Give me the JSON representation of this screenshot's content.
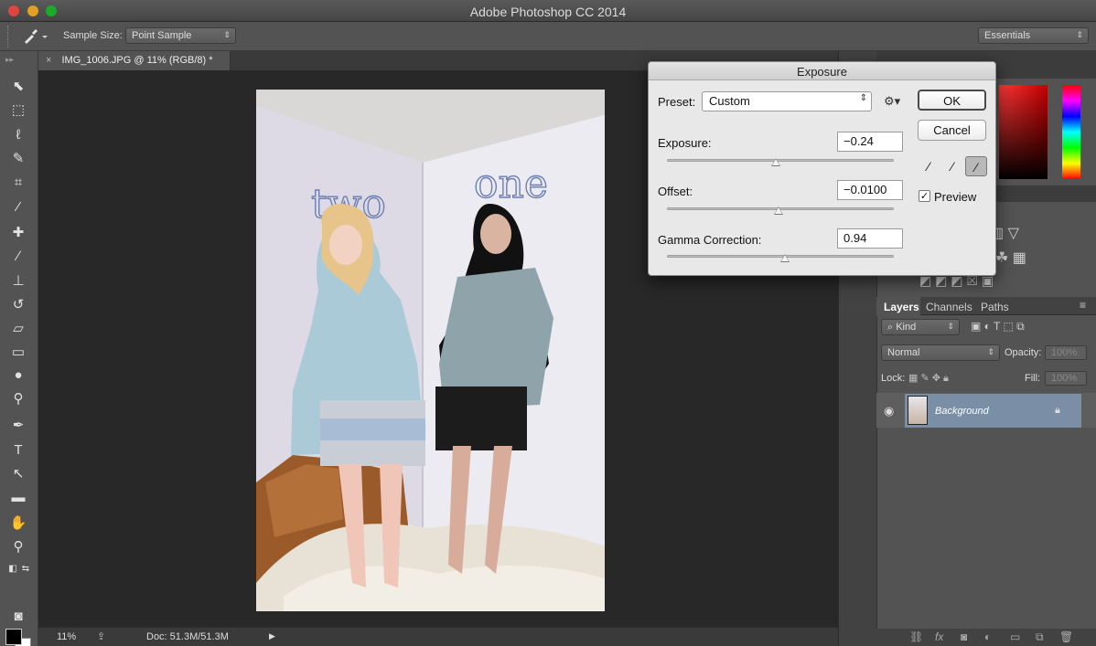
{
  "window": {
    "title": "Adobe Photoshop CC 2014"
  },
  "options_bar": {
    "tool_icon": "eyedropper-icon",
    "sample_size_label": "Sample Size:",
    "sample_size_value": "Point Sample",
    "workspace_value": "Essentials"
  },
  "document": {
    "tab_close": "×",
    "tab_label": "IMG_1006.JPG @ 11% (RGB/8) *",
    "photo_text_left": "two",
    "photo_text_right": "one"
  },
  "status": {
    "zoom": "11%",
    "doc_size": "Doc: 51.3M/51.3M"
  },
  "layers_panel": {
    "tabs": [
      "Layers",
      "Channels",
      "Paths"
    ],
    "kind_filter": "Kind",
    "blend_mode": "Normal",
    "opacity_label": "Opacity:",
    "opacity_value": "100%",
    "lock_label": "Lock:",
    "fill_label": "Fill:",
    "fill_value": "100%",
    "layer_name": "Background"
  },
  "exposure_dialog": {
    "title": "Exposure",
    "preset_label": "Preset:",
    "preset_value": "Custom",
    "exposure_label": "Exposure:",
    "exposure_value": "−0.24",
    "exposure_slider_fraction": 0.48,
    "offset_label": "Offset:",
    "offset_value": "−0.0100",
    "offset_slider_fraction": 0.49,
    "gamma_label": "Gamma Correction:",
    "gamma_value": "0.94",
    "gamma_slider_fraction": 0.52,
    "ok_label": "OK",
    "cancel_label": "Cancel",
    "preview_label": "Preview",
    "preview_checked": true
  }
}
